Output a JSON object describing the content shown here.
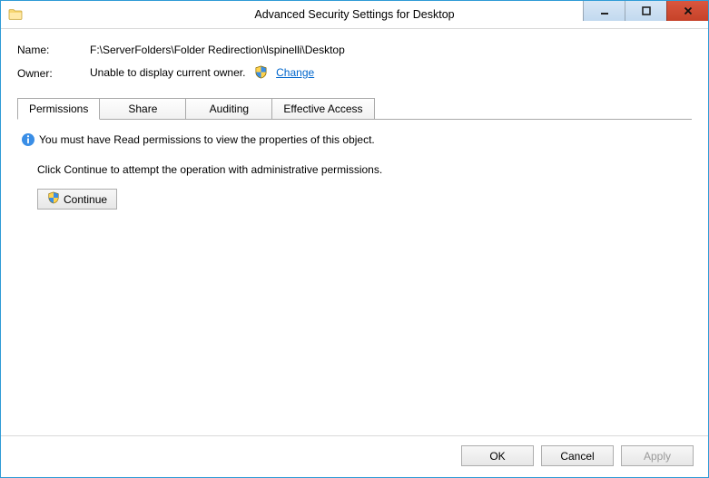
{
  "window": {
    "title": "Advanced Security Settings for Desktop"
  },
  "fields": {
    "name_label": "Name:",
    "name_value": "F:\\ServerFolders\\Folder Redirection\\lspinelli\\Desktop",
    "owner_label": "Owner:",
    "owner_value": "Unable to display current owner.",
    "change_link": "Change"
  },
  "tabs": {
    "permissions": "Permissions",
    "share": "Share",
    "auditing": "Auditing",
    "effective": "Effective Access"
  },
  "panel": {
    "info_text": "You must have Read permissions to view the properties of this object.",
    "hint_text": "Click Continue to attempt the operation with administrative permissions.",
    "continue_label": "Continue"
  },
  "footer": {
    "ok": "OK",
    "cancel": "Cancel",
    "apply": "Apply"
  }
}
